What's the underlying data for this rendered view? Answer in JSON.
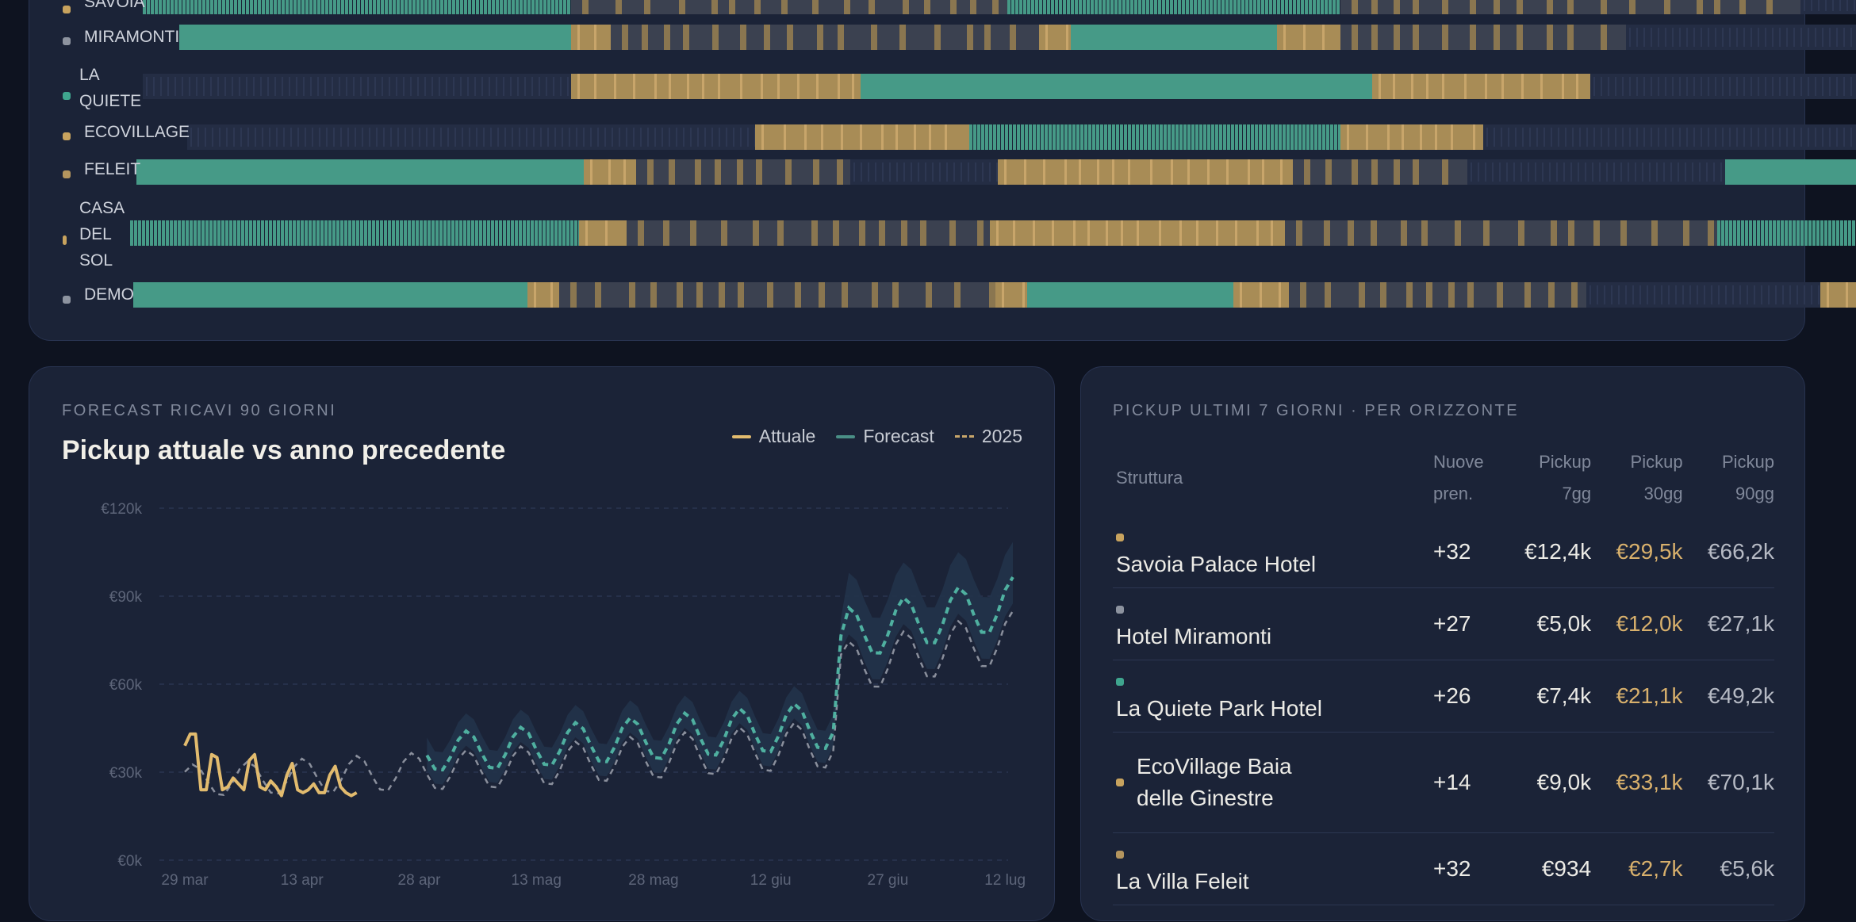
{
  "timeline": {
    "rows": [
      {
        "label": [
          "SAVOIA"
        ],
        "color": "#c8a35e"
      },
      {
        "label": [
          "MIRAMONTI"
        ],
        "color": "#8d939f"
      },
      {
        "label": [
          "LA",
          "QUIETE"
        ],
        "color": "#3fa58e"
      },
      {
        "label": [
          "ECOVILLAGE"
        ],
        "color": "#c8a35e"
      },
      {
        "label": [
          "FELEIT"
        ],
        "color": "#b4955e"
      },
      {
        "label": [
          "CASA",
          "DEL",
          "SOL"
        ],
        "color": "#c8a35e"
      },
      {
        "label": [
          "DEMO"
        ],
        "color": "#8d939f"
      }
    ],
    "colors": {
      "booked": "#469a87",
      "option": "#a88c56",
      "blocked": "#3b4150",
      "free": "#242d44"
    }
  },
  "forecast": {
    "eyebrow": "FORECAST RICAVI 90 GIORNI",
    "title": "Pickup attuale vs anno precedente",
    "legend": {
      "actual": "Attuale",
      "forecast": "Forecast",
      "prev": "2025"
    },
    "colors": {
      "actual": "#e2bb6e",
      "forecast": "#4fb0a0",
      "prev": "#8a8f9c",
      "band": "#22334a"
    }
  },
  "chart_data": {
    "type": "line",
    "ylim": [
      0,
      120000
    ],
    "yticks": [
      "€0k",
      "€30k",
      "€60k",
      "€90k",
      "€120k"
    ],
    "xticks": [
      "29 mar",
      "13 apr",
      "28 apr",
      "13 mag",
      "28 mag",
      "12 giu",
      "27 giu",
      "12 lug"
    ],
    "series": [
      {
        "name": "Attuale",
        "days": [
          0,
          22
        ],
        "values": [
          39000,
          43000,
          43000,
          24000,
          24000,
          36000,
          35000,
          24000,
          25000,
          28000,
          26000,
          24000,
          34000,
          36000,
          25000,
          24000,
          27000,
          25000,
          22000,
          29000,
          33000,
          24000,
          23000,
          24000,
          26000,
          23000,
          23000,
          29000,
          32000,
          25000,
          23000,
          22000,
          23000
        ]
      },
      {
        "name": "Forecast",
        "start_day": 31,
        "end_day": 106
      },
      {
        "name": "2025",
        "start_day": 0,
        "end_day": 106
      }
    ]
  },
  "pickup": {
    "eyebrow": "PICKUP ULTIMI 7 GIORNI · PER ORIZZONTE",
    "headers": {
      "name": "Struttura",
      "new": [
        "Nuove",
        "pren."
      ],
      "p7": [
        "Pickup",
        "7gg"
      ],
      "p30": [
        "Pickup",
        "30gg"
      ],
      "p90": [
        "Pickup",
        "90gg"
      ]
    },
    "rows": [
      {
        "name": "Savoia Palace Hotel",
        "new": "+32",
        "p7": "€12,4k",
        "p30": "€29,5k",
        "p90": "€66,2k",
        "color": "#c8a35e"
      },
      {
        "name": "Hotel Miramonti",
        "new": "+27",
        "p7": "€5,0k",
        "p30": "€12,0k",
        "p90": "€27,1k",
        "color": "#8d939f"
      },
      {
        "name": "La Quiete Park Hotel",
        "new": "+26",
        "p7": "€7,4k",
        "p30": "€21,1k",
        "p90": "€49,2k",
        "color": "#3fa58e"
      },
      {
        "name": "EcoVillage Baia delle Ginestre",
        "new": "+14",
        "p7": "€9,0k",
        "p30": "€33,1k",
        "p90": "€70,1k",
        "color": "#c8a35e"
      },
      {
        "name": "La Villa Feleit",
        "new": "+32",
        "p7": "€934",
        "p30": "€2,7k",
        "p90": "€5,6k",
        "color": "#b4955e"
      }
    ]
  }
}
